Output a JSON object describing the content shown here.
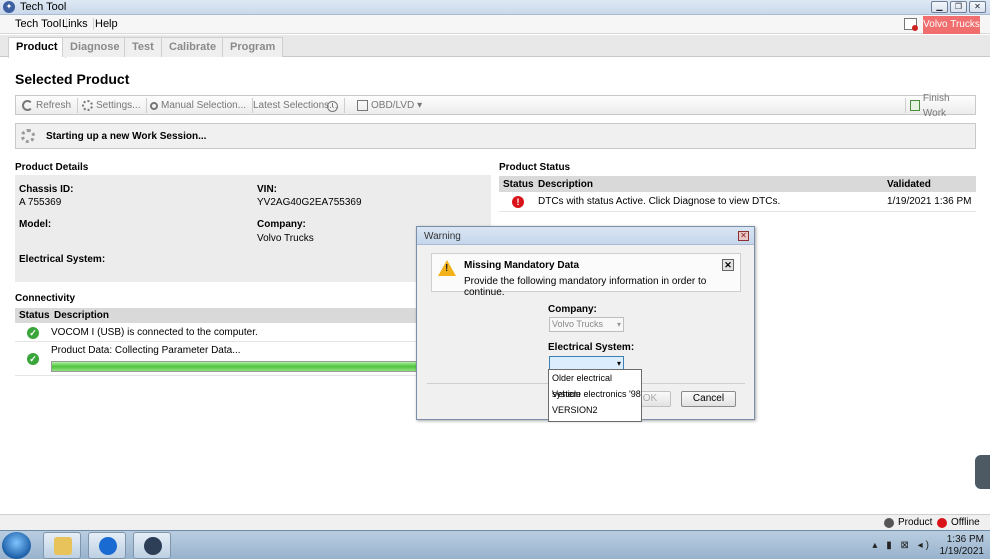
{
  "window": {
    "title": "Tech Tool"
  },
  "menu": {
    "items": [
      "Tech Tool",
      "Links",
      "Help"
    ],
    "region_badge": "Volvo Trucks"
  },
  "tabs": [
    "Product",
    "Diagnose",
    "Test",
    "Calibrate",
    "Program"
  ],
  "page_title": "Selected Product",
  "toolbar": {
    "refresh": "Refresh",
    "settings": "Settings...",
    "manual_selection": "Manual Selection...",
    "latest_selections": "Latest Selections...",
    "obd": "OBD/LVD",
    "finish": "Finish Work"
  },
  "status_message": "Starting up a new Work Session...",
  "product_details": {
    "heading": "Product Details",
    "chassis_label": "Chassis ID:",
    "chassis_value": "A 755369",
    "vin_label": "VIN:",
    "vin_value": "YV2AG40G2EA755369",
    "model_label": "Model:",
    "company_label": "Company:",
    "company_value": "Volvo Trucks",
    "electrical_label": "Electrical System:"
  },
  "product_status": {
    "heading": "Product Status",
    "columns": [
      "Status",
      "Description",
      "Validated"
    ],
    "rows": [
      {
        "description": "DTCs with status Active. Click Diagnose to view DTCs.",
        "validated": "1/19/2021 1:36 PM"
      }
    ]
  },
  "connectivity": {
    "heading": "Connectivity",
    "columns": [
      "Status",
      "Description"
    ],
    "rows": [
      "VOCOM I (USB) is connected to the computer.",
      "Product Data: Collecting Parameter Data..."
    ],
    "progress_percent": 100
  },
  "dialog": {
    "title": "Warning",
    "message_title": "Missing Mandatory Data",
    "message_text": "Provide the following mandatory information in order to continue.",
    "company_label": "Company:",
    "company_value": "Volvo Trucks",
    "electrical_label": "Electrical System:",
    "electrical_value": "",
    "options": [
      "Older electrical system",
      "Vehicle electronics '98",
      "VERSION2"
    ],
    "ok_label": "OK",
    "cancel_label": "Cancel"
  },
  "bottom_status": {
    "product": "Product",
    "offline": "Offline"
  },
  "taskbar": {
    "time": "1:36 PM",
    "date": "1/19/2021"
  },
  "colors": {
    "error": "#d8141a",
    "ok": "#3aa53a",
    "badge": "#f06e6e",
    "progress": "#4fc43e"
  }
}
